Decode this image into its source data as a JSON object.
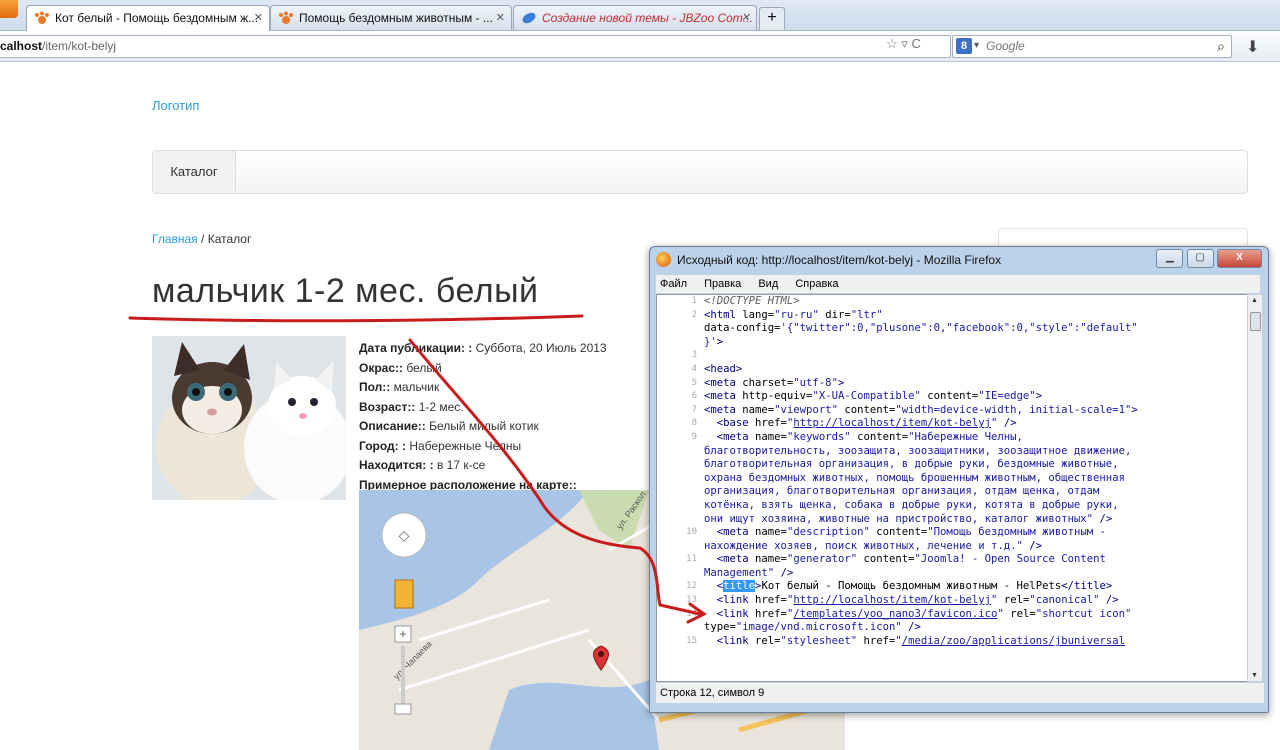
{
  "browser": {
    "tabs": [
      {
        "title": "Кот белый - Помощь бездомным ж...",
        "active": true
      },
      {
        "title": "Помощь бездомным животным - ...",
        "active": false
      },
      {
        "title": "Создание новой темы - JBZoo Com...",
        "active": false
      }
    ],
    "url_host": "calhost",
    "url_path": "/item/kot-belyj",
    "search_engine": "Google",
    "search_placeholder": "Google"
  },
  "page": {
    "logo": "Логотип",
    "menu": [
      "Каталог"
    ],
    "breadcrumbs": {
      "home": "Главная",
      "sep": " / ",
      "current": "Каталог"
    },
    "title": "мальчик 1-2 мес. белый",
    "fields": [
      {
        "label": "Дата публикации: :",
        "value": " Суббота, 20 Июль 2013"
      },
      {
        "label": "Окрас::",
        "value": " белый"
      },
      {
        "label": "Пол::",
        "value": " мальчик"
      },
      {
        "label": "Возраст::",
        "value": " 1-2 мес."
      },
      {
        "label": "Описание::",
        "value": " Белый милый котик"
      },
      {
        "label": "Город: :",
        "value": " Набережные Челны"
      },
      {
        "label": "Находится: :",
        "value": " в 17 к-се"
      },
      {
        "label": "Примерное расположение на карте::",
        "value": ""
      }
    ],
    "map_labels": [
      "ул. Раскол",
      "ул. Чапаева"
    ]
  },
  "source_window": {
    "title": "Исходный код: http://localhost/item/kot-belyj - Mozilla Firefox",
    "menu": [
      "Файл",
      "Правка",
      "Вид",
      "Справка"
    ],
    "status": "Строка 12, символ 9",
    "lines": [
      {
        "n": "1",
        "html": "<span class=\"cm\">&lt;!DOCTYPE HTML&gt;</span>"
      },
      {
        "n": "2",
        "html": "<span class=\"tag\">&lt;html</span> lang=<span class=\"val\">\"ru-ru\"</span> dir=<span class=\"val\">\"ltr\"</span>"
      },
      {
        "n": "",
        "html": "data-config=<span class=\"val\">'{\"twitter\":0,\"plusone\":0,\"facebook\":0,\"style\":\"default\"</span>"
      },
      {
        "n": "",
        "html": "<span class=\"val\">}'</span><span class=\"tag\">&gt;</span>"
      },
      {
        "n": "3",
        "html": ""
      },
      {
        "n": "4",
        "html": "<span class=\"tag\">&lt;head&gt;</span>"
      },
      {
        "n": "5",
        "html": "<span class=\"tag\">&lt;meta</span> charset=<span class=\"val\">\"utf-8\"</span><span class=\"tag\">&gt;</span>"
      },
      {
        "n": "6",
        "html": "<span class=\"tag\">&lt;meta</span> http-equiv=<span class=\"val\">\"X-UA-Compatible\"</span> content=<span class=\"val\">\"IE=edge\"</span><span class=\"tag\">&gt;</span>"
      },
      {
        "n": "7",
        "html": "<span class=\"tag\">&lt;meta</span> name=<span class=\"val\">\"viewport\"</span> content=<span class=\"val\">\"width=device-width, initial-scale=1\"</span><span class=\"tag\">&gt;</span>"
      },
      {
        "n": "8",
        "html": "  <span class=\"tag\">&lt;base</span> href=<span class=\"val\">\"<span class=\"lnk\">http://localhost/item/kot-belyj</span>\"</span> <span class=\"tag\">/&gt;</span>"
      },
      {
        "n": "9",
        "html": "  <span class=\"tag\">&lt;meta</span> name=<span class=\"val\">\"keywords\"</span> content=<span class=\"val\">\"Набережные Челны,</span>"
      },
      {
        "n": "",
        "html": "<span class=\"val\">благотворительность, зоозащита, зоозащитники, зоозащитное движение,</span>"
      },
      {
        "n": "",
        "html": "<span class=\"val\">благотворительная организация, в добрые руки, бездомные животные,</span>"
      },
      {
        "n": "",
        "html": "<span class=\"val\">охрана бездомных животных, помощь брошенным животным, общественная</span>"
      },
      {
        "n": "",
        "html": "<span class=\"val\">организация, благотворительная организация, отдам щенка, отдам</span>"
      },
      {
        "n": "",
        "html": "<span class=\"val\">котёнка, взять щенка, собака в добрые руки, котята в добрые руки,</span>"
      },
      {
        "n": "",
        "html": "<span class=\"val\">они ищут хозяина, животные на пристройство, каталог животных\"</span> <span class=\"tag\">/&gt;</span>"
      },
      {
        "n": "10",
        "html": "  <span class=\"tag\">&lt;meta</span> name=<span class=\"val\">\"description\"</span> content=<span class=\"val\">\"Помощь бездомным животным -</span>"
      },
      {
        "n": "",
        "html": "<span class=\"val\">нахождение хозяев, поиск животных, лечение и т.д.\"</span> <span class=\"tag\">/&gt;</span>"
      },
      {
        "n": "11",
        "html": "  <span class=\"tag\">&lt;meta</span> name=<span class=\"val\">\"generator\"</span> content=<span class=\"val\">\"Joomla! - Open Source Content</span>"
      },
      {
        "n": "",
        "html": "<span class=\"val\">Management\"</span> <span class=\"tag\">/&gt;</span>"
      },
      {
        "n": "12",
        "html": "  <span class=\"tag\">&lt;<span class=\"sel\">title</span>&gt;</span>Кот белый - Помощь бездомным животным - HelPets<span class=\"tag\">&lt;/title&gt;</span>"
      },
      {
        "n": "13",
        "html": "  <span class=\"tag\">&lt;link</span> href=<span class=\"val\">\"<span class=\"lnk\">http://localhost/item/kot-belyj</span>\"</span> rel=<span class=\"val\">\"canonical\"</span> <span class=\"tag\">/&gt;</span>"
      },
      {
        "n": "14",
        "html": "  <span class=\"tag\">&lt;link</span> href=<span class=\"val\">\"<span class=\"lnk\">/templates/yoo_nano3/favicon.ico</span>\"</span> rel=<span class=\"val\">\"shortcut icon\"</span>"
      },
      {
        "n": "",
        "html": "type=<span class=\"val\">\"image/vnd.microsoft.icon\"</span> <span class=\"tag\">/&gt;</span>"
      },
      {
        "n": "15",
        "html": "  <span class=\"tag\">&lt;link</span> rel=<span class=\"val\">\"stylesheet\"</span> href=<span class=\"val\">\"<span class=\"lnk\">/media/zoo/applications/jbuniversal</span></span>"
      }
    ]
  }
}
